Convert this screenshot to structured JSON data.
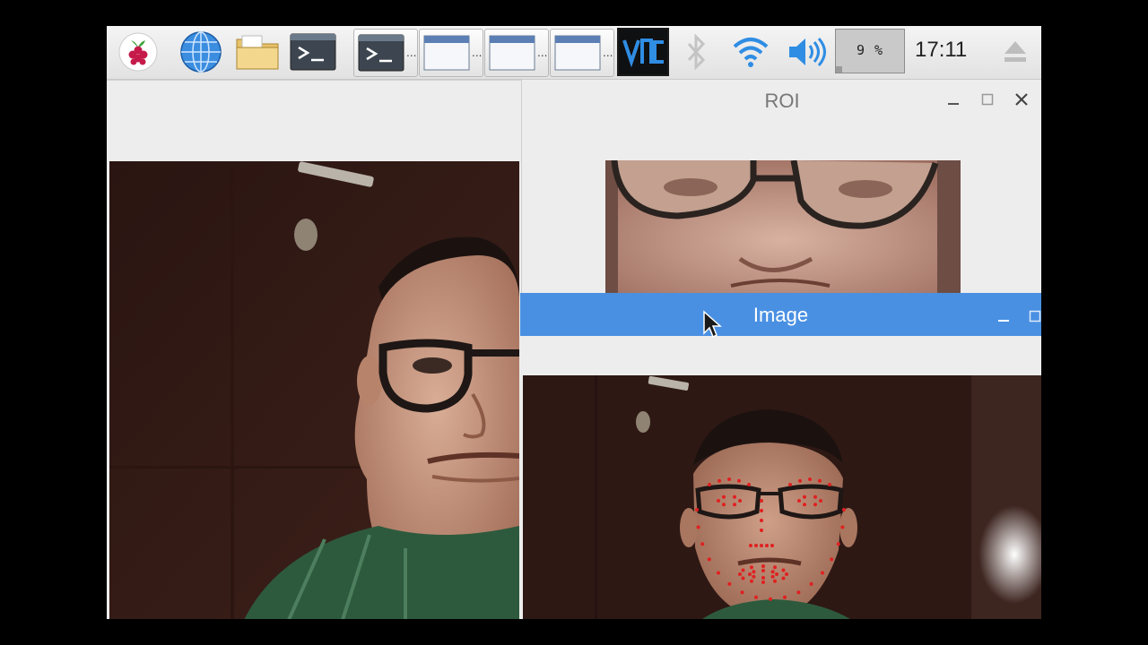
{
  "taskbar": {
    "menu_icon": "raspberry-pi-icon",
    "launchers": [
      "globe-browser-icon",
      "file-manager-folder-icon",
      "terminal-icon"
    ],
    "tasks": [
      {
        "icon": "terminal-icon",
        "label": "..."
      },
      {
        "icon": "window-icon",
        "label": "..."
      },
      {
        "icon": "window-icon",
        "label": "..."
      },
      {
        "icon": "window-icon",
        "label": "..."
      }
    ],
    "tray": {
      "vnc_icon": "vnc-icon",
      "bluetooth_icon": "bluetooth-icon",
      "wifi_icon": "wifi-icon",
      "volume_icon": "volume-icon",
      "cpu_usage": "9 %",
      "cpu_fraction": 0.09,
      "clock": "17:11",
      "eject_icon": "eject-icon"
    }
  },
  "windows": {
    "roi": {
      "title": "ROI"
    },
    "image": {
      "title": "Image",
      "accent": "#4a90e2"
    }
  }
}
